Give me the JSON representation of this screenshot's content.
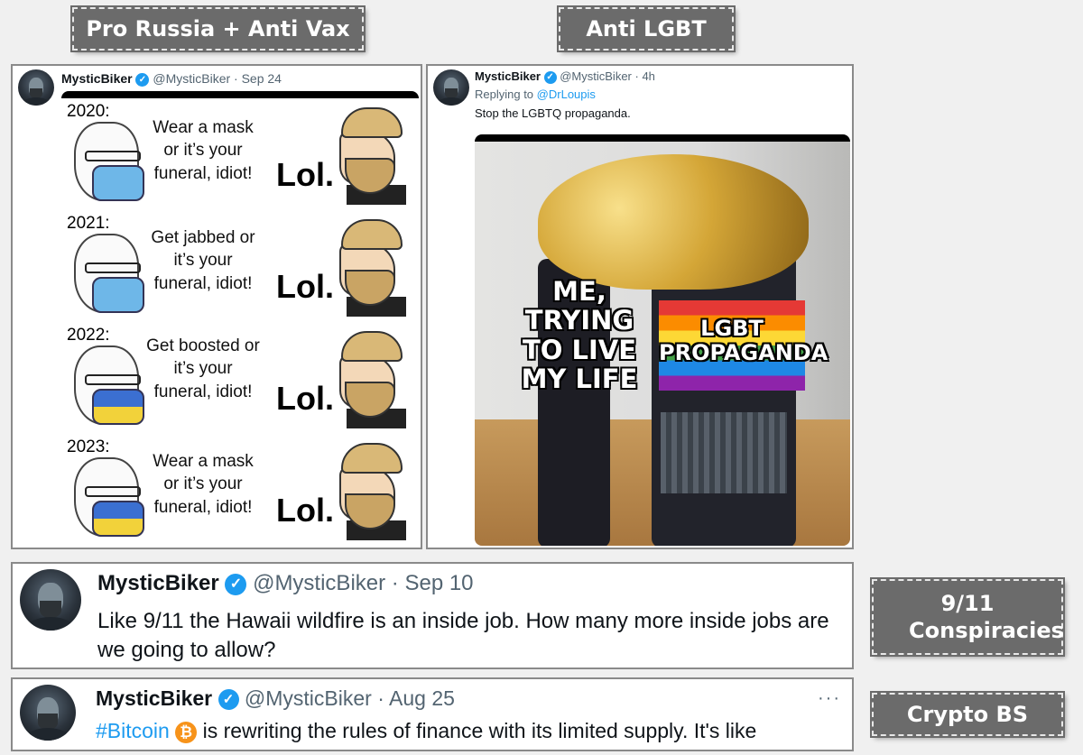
{
  "labels": {
    "russia": "Pro Russia + Anti Vax",
    "lgbt": "Anti LGBT",
    "nine_eleven": "9/11 Conspiracies",
    "crypto": "Crypto BS"
  },
  "colors": {
    "verified": "#1d9bf0",
    "label_bg": "#6b6b6b",
    "bitcoin": "#f7931a"
  },
  "tweet1": {
    "name": "MysticBiker",
    "handle": "@MysticBiker",
    "date": "· Sep 24",
    "meme": {
      "rows": [
        {
          "year": "2020:",
          "quote": "Wear a mask or it’s your funeral, idiot!",
          "reply": "Lol."
        },
        {
          "year": "2021:",
          "quote": "Get jabbed or it’s your funeral, idiot!",
          "reply": "Lol."
        },
        {
          "year": "2022:",
          "quote": "Get boosted or it’s your funeral, idiot!",
          "reply": "Lol."
        },
        {
          "year": "2023:",
          "quote": "Wear a mask or it’s your funeral, idiot!",
          "reply": "Lol."
        }
      ]
    }
  },
  "tweet2": {
    "name": "MysticBiker",
    "handle": "@MysticBiker",
    "date": "· 4h",
    "replying_prefix": "Replying to",
    "replying_to": "@DrLoupis",
    "text": "Stop the LGBTQ propaganda.",
    "meme": {
      "caption_left": "ME, TRYING TO LIVE MY LIFE",
      "caption_right": "LGBT PROPAGANDA"
    }
  },
  "tweet3": {
    "name": "MysticBiker",
    "handle": "@MysticBiker",
    "date": "· Sep 10",
    "text": "Like 9/11 the Hawaii wildfire is an inside job. How many more inside jobs are we going to allow?"
  },
  "tweet4": {
    "name": "MysticBiker",
    "handle": "@MysticBiker",
    "date": "· Aug 25",
    "hashtag": "#Bitcoin",
    "text": "is rewriting the rules of finance with its limited supply. It's like",
    "more": "···"
  }
}
